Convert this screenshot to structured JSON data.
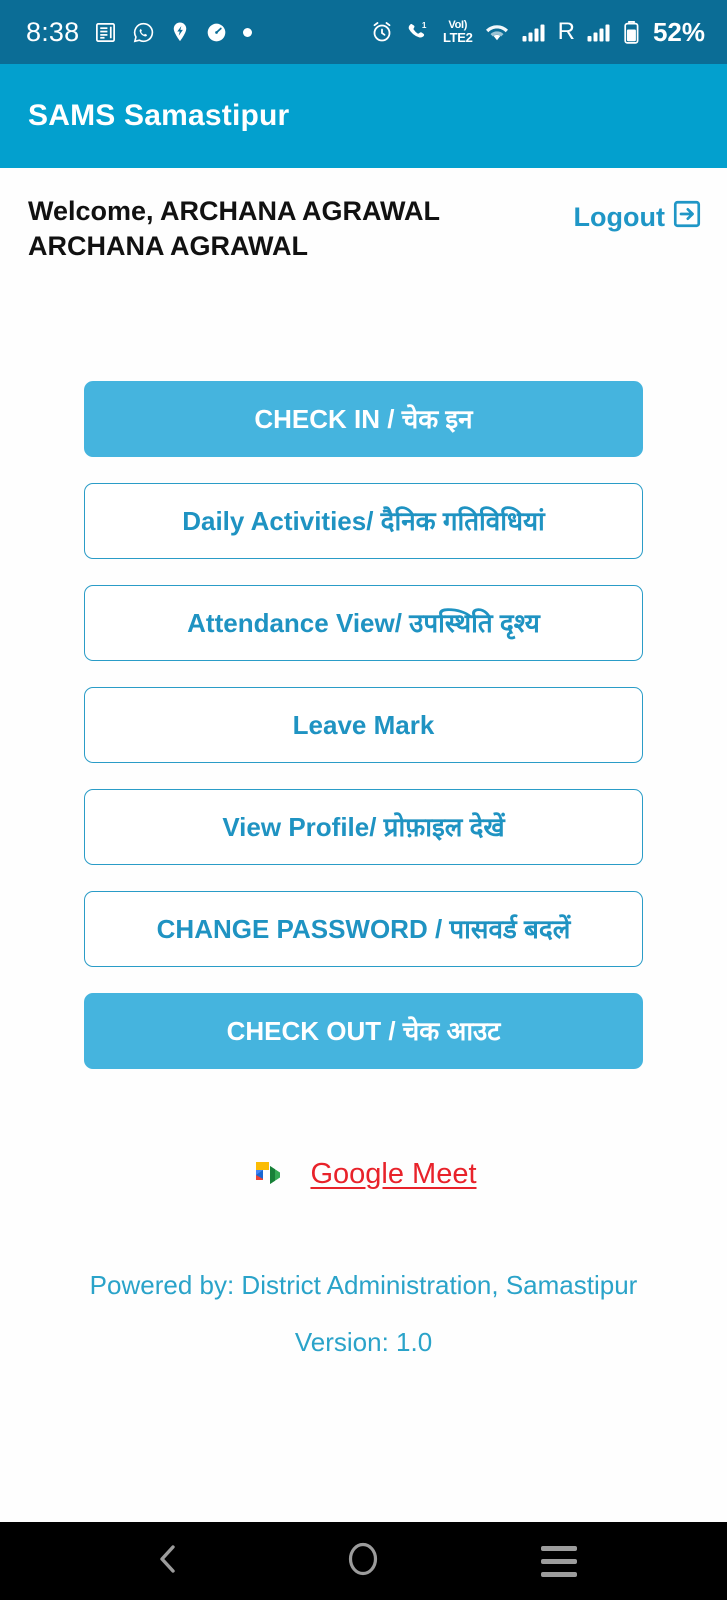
{
  "statusbar": {
    "time": "8:38",
    "left_icons": [
      "news-icon",
      "whatsapp-icon",
      "location-pin-icon",
      "speedometer-icon",
      "dot-icon"
    ],
    "alarm_icon": "alarm-icon",
    "call_icon": "call-forward-icon",
    "call_badge": "1",
    "volte_line1": "VoI)",
    "volte_line2": "LTE2",
    "wifi_icon": "wifi-icon",
    "signal_icon": "signal-bars-icon",
    "roaming": "R",
    "signal_icon_2": "signal-bars-icon",
    "battery_icon": "battery-icon",
    "battery": "52%"
  },
  "appbar": {
    "title": "SAMS Samastipur"
  },
  "welcome": {
    "text": "Welcome, ARCHANA AGRAWAL ARCHANA AGRAWAL",
    "logout_label": "Logout",
    "logout_icon": "logout-exit-icon"
  },
  "actions": [
    {
      "label": "CHECK IN / चेक इन",
      "style": "filled",
      "name": "check-in-button"
    },
    {
      "label": "Daily Activities/ दैनिक गतिविधियां",
      "style": "outline",
      "name": "daily-activities-button"
    },
    {
      "label": "Attendance View/ उपस्थिति दृश्य",
      "style": "outline",
      "name": "attendance-view-button"
    },
    {
      "label": "Leave Mark",
      "style": "outline",
      "name": "leave-mark-button"
    },
    {
      "label": "View Profile/ प्रोफ़ाइल देखें",
      "style": "outline",
      "name": "view-profile-button"
    },
    {
      "label": "CHANGE PASSWORD / पासवर्ड बदलें",
      "style": "outline",
      "name": "change-password-button"
    },
    {
      "label": "CHECK OUT / चेक आउट",
      "style": "filled",
      "name": "check-out-button"
    }
  ],
  "meet": {
    "label": "Google Meet",
    "icon": "google-meet-icon"
  },
  "footer": {
    "powered_by": "Powered by: District Administration, Samastipur",
    "version": "Version: 1.0"
  },
  "navbar": {
    "back": "back-chevron-icon",
    "home": "home-circle-icon",
    "recents": "recents-menu-icon"
  },
  "colors": {
    "statusbar_bg": "#0b6d96",
    "appbar_bg": "#03a0ce",
    "filled_button": "#45b4de",
    "outline_accent": "#2a9cc7",
    "link_red": "#e8222a",
    "footer_text": "#2aa3c9"
  }
}
